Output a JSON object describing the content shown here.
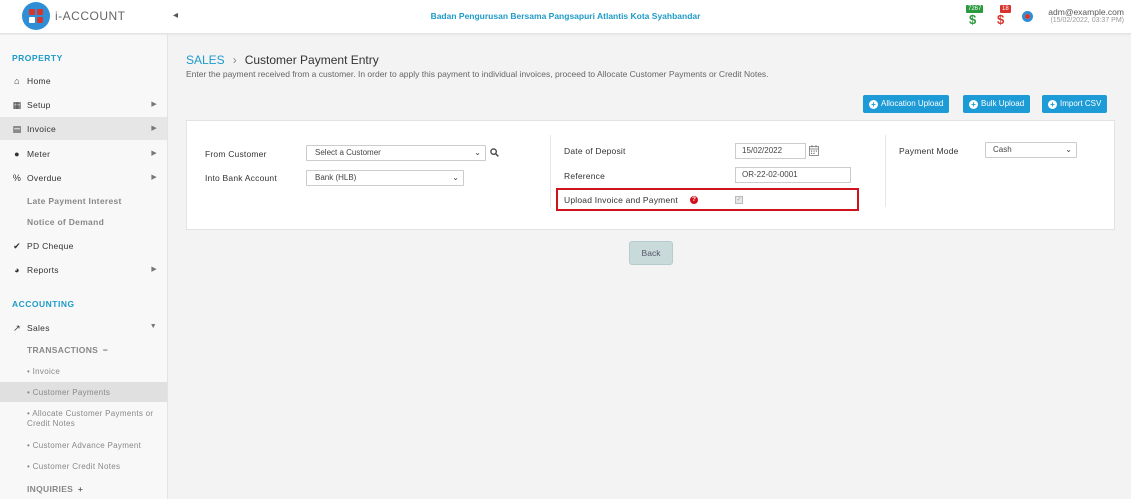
{
  "header": {
    "logo_text": "i-ACCOUNT",
    "toggle_icon": "chevron-left-icon",
    "title": "Badan Pengurusan Bersama Pangsapuri Atlantis Kota Syahbandar",
    "badge_green_count": "7267",
    "badge_red_count": "18",
    "user_email": "adm@example.com",
    "user_datetime": "(15/02/2022, 03:37 PM)",
    "colors": {
      "accent": "#1e9bc8",
      "green": "#2a9a3c",
      "red": "#d9342b"
    }
  },
  "sidebar": {
    "property_section": "PROPERTY",
    "items": [
      {
        "label": "Home",
        "icon": "home-icon"
      },
      {
        "label": "Setup",
        "icon": "grid-icon"
      },
      {
        "label": "Invoice",
        "icon": "file-icon"
      },
      {
        "label": "Meter",
        "icon": "droplet-icon"
      },
      {
        "label": "Overdue",
        "icon": "percent-icon"
      }
    ],
    "overdue_subs": [
      "Late Payment Interest",
      "Notice of Demand"
    ],
    "pd_cheque": "PD Cheque",
    "reports": "Reports",
    "accounting_section": "ACCOUNTING",
    "sales": "Sales",
    "transactions": "TRANSACTIONS",
    "transactions_toggle": "−",
    "leaves": [
      "Invoice",
      "Customer Payments",
      "Allocate Customer Payments or Credit Notes",
      "Customer Advance Payment",
      "Customer Credit Notes"
    ],
    "inquiries": "INQUIRIES",
    "inquiries_toggle": "+"
  },
  "main": {
    "breadcrumb_section": "SALES",
    "breadcrumb_sep": "›",
    "page_title": "Customer Payment Entry",
    "description": "Enter the payment received from a customer. In order to apply this payment to individual invoices, proceed to Allocate Customer Payments or Credit Notes.",
    "buttons": {
      "allocation_upload": "Allocation Upload",
      "bulk_upload": "Bulk Upload",
      "import_csv": "Import CSV"
    },
    "form": {
      "from_customer_label": "From Customer",
      "from_customer_value": "Select a Customer",
      "into_bank_label": "Into Bank Account",
      "into_bank_value": "Bank (HLB)",
      "date_label": "Date of Deposit",
      "date_value": "15/02/2022",
      "reference_label": "Reference",
      "reference_value": "OR-22-02-0001",
      "upload_label": "Upload Invoice and Payment",
      "payment_mode_label": "Payment Mode",
      "payment_mode_value": "Cash"
    },
    "back_button": "Back"
  }
}
